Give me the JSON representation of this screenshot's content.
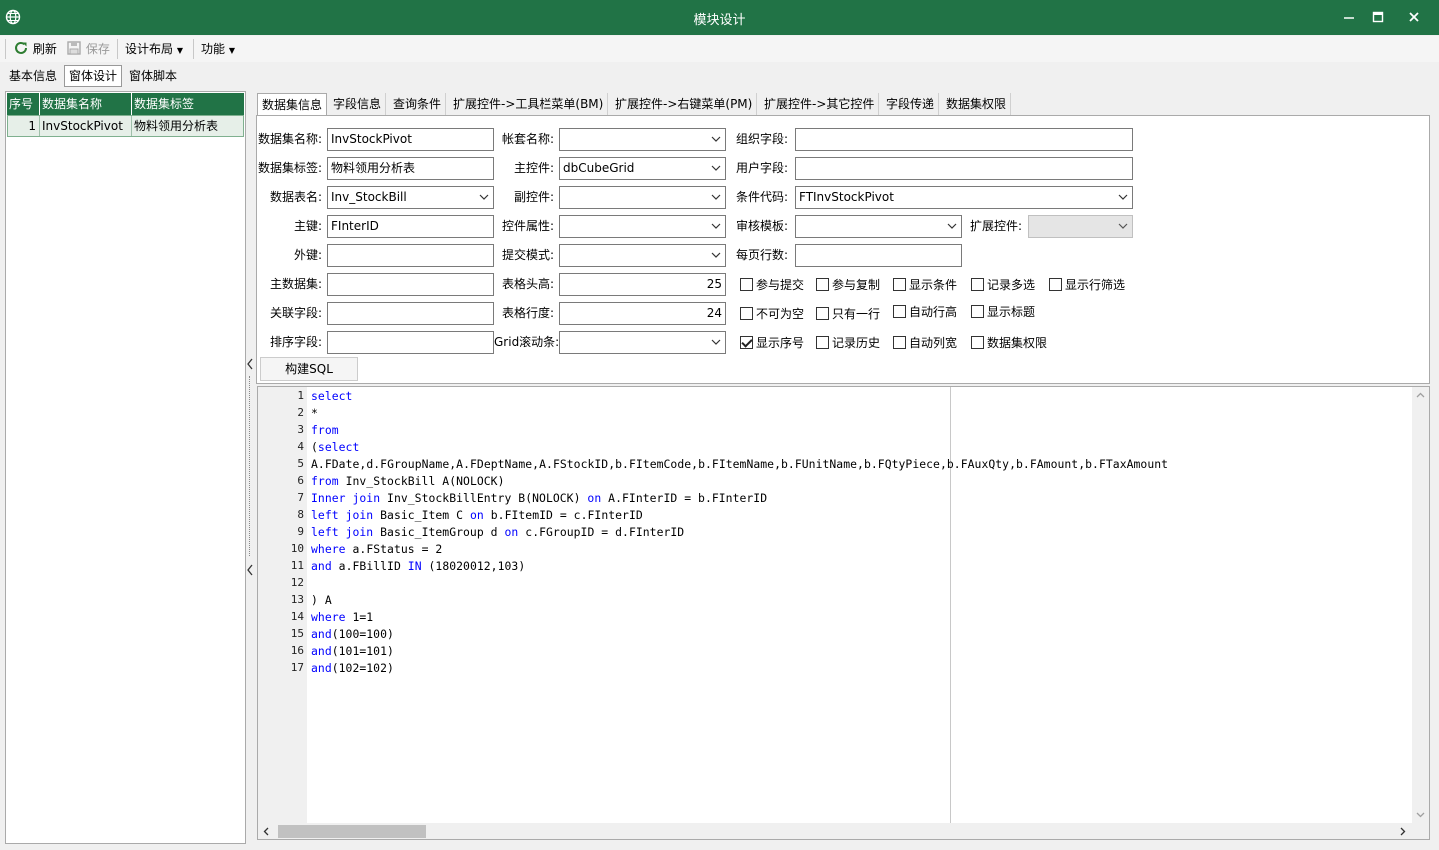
{
  "window": {
    "title": "模块设计"
  },
  "toolbar": {
    "refresh": "刷新",
    "save": "保存",
    "layout": "设计布局",
    "functions": "功能"
  },
  "main_tabs": [
    "基本信息",
    "窗体设计",
    "窗体脚本"
  ],
  "dataset_list": {
    "headers": [
      "序号",
      "数据集名称",
      "数据集标签"
    ],
    "rows": [
      {
        "index": "1",
        "name": "InvStockPivot",
        "label": "物料领用分析表"
      }
    ]
  },
  "sub_tabs": [
    "数据集信息",
    "字段信息",
    "查询条件",
    "扩展控件->工具栏菜单(BM)",
    "扩展控件->右键菜单(PM)",
    "扩展控件->其它控件",
    "字段传递",
    "数据集权限"
  ],
  "form": {
    "dataset_name": {
      "label": "数据集名称:",
      "value": "InvStockPivot"
    },
    "dataset_label": {
      "label": "数据集标签:",
      "value": "物料领用分析表"
    },
    "table_name": {
      "label": "数据表名:",
      "value": "Inv_StockBill"
    },
    "primary_key": {
      "label": "主键:",
      "value": "FInterID"
    },
    "foreign_key": {
      "label": "外键:",
      "value": ""
    },
    "master_dataset": {
      "label": "主数据集:",
      "value": ""
    },
    "link_field": {
      "label": "关联字段:",
      "value": ""
    },
    "sort_field": {
      "label": "排序字段:",
      "value": ""
    },
    "account_name": {
      "label": "帐套名称:",
      "value": ""
    },
    "main_control": {
      "label": "主控件:",
      "value": "dbCubeGrid"
    },
    "sub_control": {
      "label": "副控件:",
      "value": ""
    },
    "control_props": {
      "label": "控件属性:",
      "value": ""
    },
    "submit_mode": {
      "label": "提交模式:",
      "value": ""
    },
    "header_height": {
      "label": "表格头高:",
      "value": "25"
    },
    "row_height": {
      "label": "表格行度:",
      "value": "24"
    },
    "grid_scroll": {
      "label": "Grid滚动条:",
      "value": ""
    },
    "org_field": {
      "label": "组织字段:",
      "value": ""
    },
    "user_field": {
      "label": "用户字段:",
      "value": ""
    },
    "condition_code": {
      "label": "条件代码:",
      "value": "FTInvStockPivot"
    },
    "audit_template": {
      "label": "审核模板:",
      "value": ""
    },
    "ext_control": {
      "label": "扩展控件:",
      "value": ""
    },
    "page_rows": {
      "label": "每页行数:",
      "value": ""
    }
  },
  "checkboxes": [
    {
      "label": "参与提交",
      "checked": false
    },
    {
      "label": "参与复制",
      "checked": false
    },
    {
      "label": "显示条件",
      "checked": false
    },
    {
      "label": "记录多选",
      "checked": false
    },
    {
      "label": "显示行筛选",
      "checked": false
    },
    {
      "label": "不可为空",
      "checked": false
    },
    {
      "label": "只有一行",
      "checked": false
    },
    {
      "label": "自动行高",
      "checked": false
    },
    {
      "label": "显示标题",
      "checked": false
    },
    {
      "label": "显示序号",
      "checked": true
    },
    {
      "label": "记录历史",
      "checked": false
    },
    {
      "label": "自动列宽",
      "checked": false
    },
    {
      "label": "数据集权限",
      "checked": false
    }
  ],
  "build_sql_button": "构建SQL",
  "sql_lines": [
    "select",
    "*",
    "from",
    "(select",
    "A.FDate,d.FGroupName,A.FDeptName,A.FStockID,b.FItemCode,b.FItemName,b.FUnitName,b.FQtyPiece,b.FAuxQty,b.FAmount,b.FTaxAmount",
    "from Inv_StockBill A(NOLOCK)",
    "Inner join Inv_StockBillEntry B(NOLOCK) on A.FInterID = b.FInterID",
    "left join Basic_Item C on b.FItemID = c.FInterID",
    "left join Basic_ItemGroup d on c.FGroupID = d.FInterID",
    "where a.FStatus = 2",
    "and a.FBillID IN (18020012,103)",
    "",
    ") A",
    "where 1=1",
    "and(100=100)",
    "and(101=101)",
    "and(102=102)"
  ],
  "colors": {
    "title_bar": "#217346",
    "keyword": "#0000ff"
  }
}
